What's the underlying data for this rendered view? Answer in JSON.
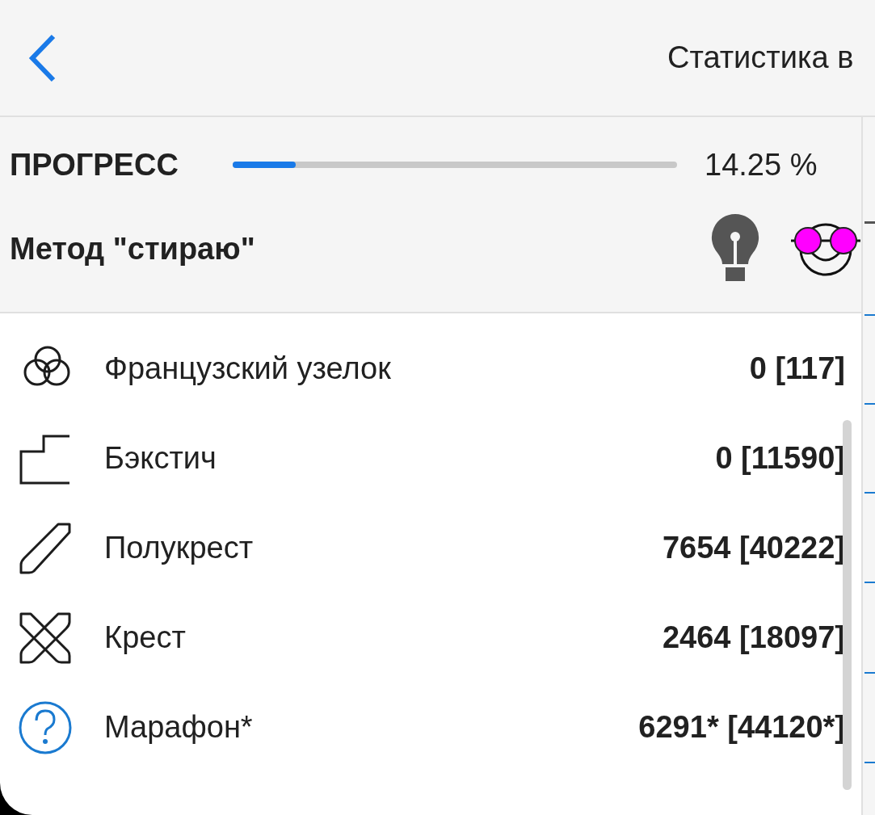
{
  "header": {
    "title": "Статистика в"
  },
  "progress": {
    "label": "ПРОГРЕСС",
    "level": 0.1425,
    "reading": "14.25 %"
  },
  "method": {
    "label": "Метод \"стираю\""
  },
  "rows": [
    {
      "kind": "knot",
      "name": "Французский узелок",
      "value": "0 [117]"
    },
    {
      "kind": "backstitch",
      "name": "Бэкстич",
      "value": "0 [11590]"
    },
    {
      "kind": "half",
      "name": "Полукрест",
      "value": "7654 [40222]"
    },
    {
      "kind": "cross",
      "name": "Крест",
      "value": "2464 [18097]"
    },
    {
      "kind": "marathon",
      "name": "Марафон*",
      "value": "6291* [44120*]"
    }
  ]
}
